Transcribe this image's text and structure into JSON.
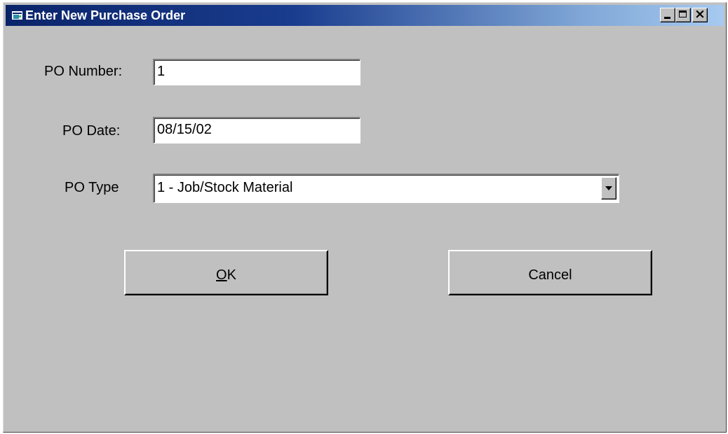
{
  "window": {
    "title": "Enter New Purchase Order",
    "controls": {
      "minimize": "minimize-icon",
      "maximize": "maximize-icon",
      "close": "close-icon"
    }
  },
  "form": {
    "po_number_label": "PO Number:",
    "po_number_value": "1",
    "po_date_label": "PO Date:",
    "po_date_value": "08/15/02",
    "po_type_label": "PO Type",
    "po_type_selected": "1 - Job/Stock Material"
  },
  "buttons": {
    "ok_mnemonic": "O",
    "ok_rest": "K",
    "cancel_label": "Cancel"
  },
  "colors": {
    "titlebar_start": "#0a246a",
    "titlebar_end": "#a6caf0",
    "window_bg": "#c0c0c0"
  }
}
